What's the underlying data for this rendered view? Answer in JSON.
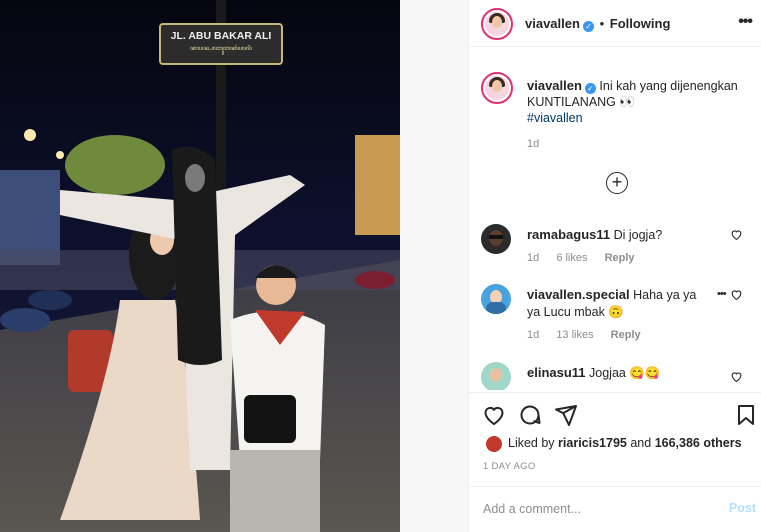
{
  "post_image": {
    "street_sign_line1": "JL. ABU BAKAR ALI",
    "street_sign_line2": "ꦗꦭꦤ꧀ꦲꦧꦸꦧꦏꦂꦲꦭꦶ"
  },
  "header": {
    "username": "viavallen",
    "separator": "•",
    "follow_status": "Following",
    "more_icon": "more-horizontal-icon"
  },
  "caption": {
    "username": "viavallen",
    "text": "Ini kah yang dijenengkan KUNTILANANG",
    "emoji": "👀",
    "hashtag": "#viavallen",
    "time": "1d"
  },
  "comments": [
    {
      "username": "ramabagus11",
      "text": "Di jogja?",
      "time": "1d",
      "likes": "6 likes",
      "reply": "Reply",
      "avatar_color": "#2b2b2b"
    },
    {
      "username": "viavallen.special",
      "text": "Haha ya ya ya Lucu mbak 🙃",
      "time": "1d",
      "likes": "13 likes",
      "reply": "Reply",
      "avatar_color": "#4aa3df"
    },
    {
      "username": "elinasu11",
      "text": "Jogjaa 😋😋",
      "avatar_color": "#9fd8c8"
    }
  ],
  "likes": {
    "prefix": "Liked by",
    "user": "riaricis1795",
    "and": "and",
    "others": "166,386 others"
  },
  "timestamp": "1 DAY AGO",
  "add_comment": {
    "placeholder": "Add a comment...",
    "post_label": "Post"
  },
  "colors": {
    "verified": "#3897f0",
    "link": "#00376b",
    "muted": "#8e8e8e",
    "post_disabled": "#b2dffc"
  }
}
